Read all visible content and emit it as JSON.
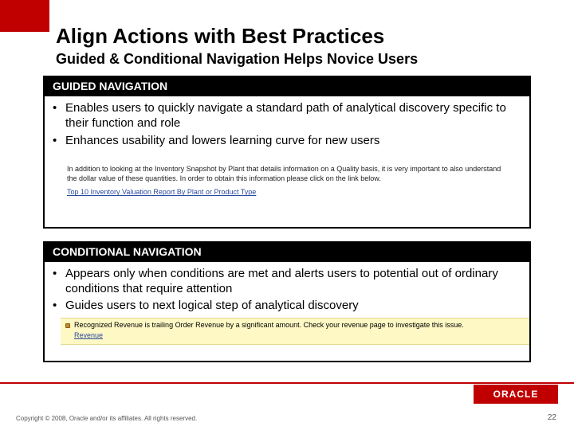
{
  "title": "Align Actions with Best Practices",
  "subtitle": "Guided & Conditional Navigation Helps Novice Users",
  "panels": {
    "guided": {
      "header": "GUIDED NAVIGATION",
      "bullets": [
        "Enables users to quickly navigate a standard path of analytical discovery specific to their function and role",
        "Enhances usability and lowers learning curve for new users"
      ],
      "note": "In addition to looking at the Inventory Snapshot by Plant that details information on a Quality basis, it is very important to also understand the dollar value of these quantities. In order to obtain this information please click on the link below.",
      "note_link": "Top 10 Inventory Valuation Report By Plant or Product Type"
    },
    "conditional": {
      "header": "CONDITIONAL NAVIGATION",
      "bullets": [
        "Appears only when conditions are met and alerts users to potential out of ordinary conditions that require attention",
        "Guides users to next logical step of analytical discovery"
      ],
      "alert_text": "Recognized Revenue is trailing Order Revenue by a significant amount. Check your revenue page to investigate this issue.",
      "alert_link": "Revenue"
    }
  },
  "brand": "ORACLE",
  "copyright": "Copyright © 2008, Oracle and/or its affiliates. All rights reserved.",
  "page": "22"
}
